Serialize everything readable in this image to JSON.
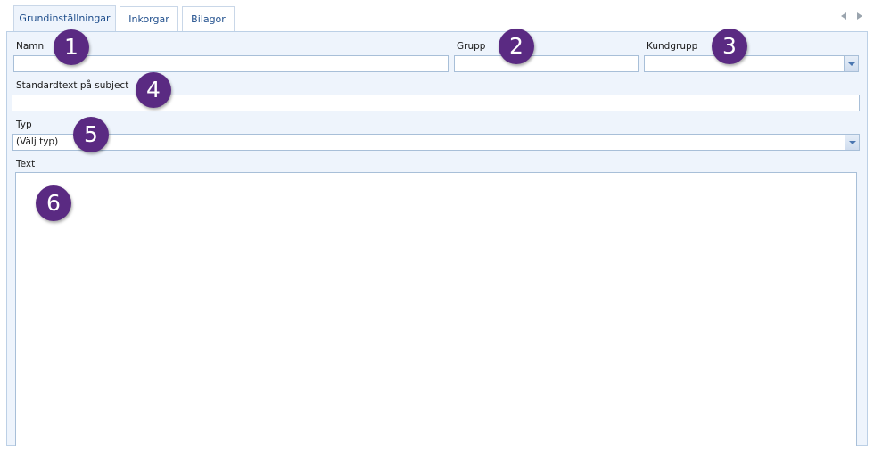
{
  "tabs": [
    {
      "label": "Grundinställningar",
      "active": true
    },
    {
      "label": "Inkorgar",
      "active": false
    },
    {
      "label": "Bilagor",
      "active": false
    }
  ],
  "form": {
    "name_label": "Namn",
    "name_value": "",
    "group_label": "Grupp",
    "group_value": "",
    "customer_group_label": "Kundgrupp",
    "customer_group_value": "",
    "subject_label": "Standardtext på subject",
    "subject_value": "",
    "type_label": "Typ",
    "type_value": "(Välj typ)",
    "text_label": "Text",
    "text_value": ""
  },
  "badges": [
    "1",
    "2",
    "3",
    "4",
    "5",
    "6"
  ],
  "colors": {
    "accent": "#1f4e8c",
    "panel_bg": "#eef4fc",
    "field_border": "#a8bfd8",
    "badge": "#5a2a82"
  },
  "icons": {
    "prev": "triangle-left-icon",
    "next": "triangle-right-icon",
    "dropdown": "chevron-down-icon"
  }
}
